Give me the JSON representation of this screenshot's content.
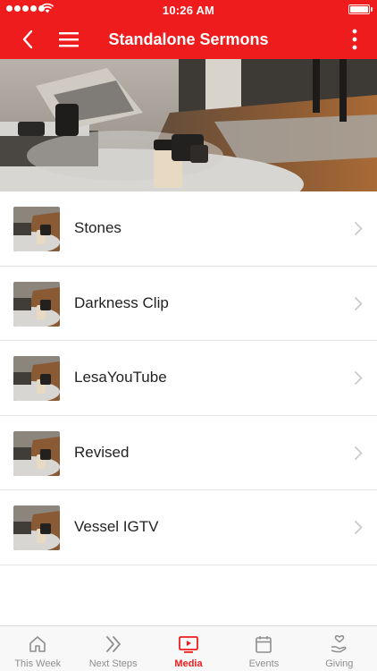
{
  "status_bar": {
    "time": "10:26 AM"
  },
  "nav": {
    "title": "Standalone Sermons"
  },
  "colors": {
    "accent": "#ee1c1c",
    "inactive": "#8e8e8e"
  },
  "list": {
    "items": [
      {
        "label": "Stones"
      },
      {
        "label": "Darkness Clip"
      },
      {
        "label": "LesaYouTube"
      },
      {
        "label": "Revised"
      },
      {
        "label": "Vessel IGTV"
      }
    ]
  },
  "tabs": [
    {
      "label": "This Week",
      "icon": "home-icon",
      "active": false
    },
    {
      "label": "Next Steps",
      "icon": "double-chevron-icon",
      "active": false
    },
    {
      "label": "Media",
      "icon": "play-screen-icon",
      "active": true
    },
    {
      "label": "Events",
      "icon": "calendar-icon",
      "active": false
    },
    {
      "label": "Giving",
      "icon": "heart-hand-icon",
      "active": false
    }
  ]
}
